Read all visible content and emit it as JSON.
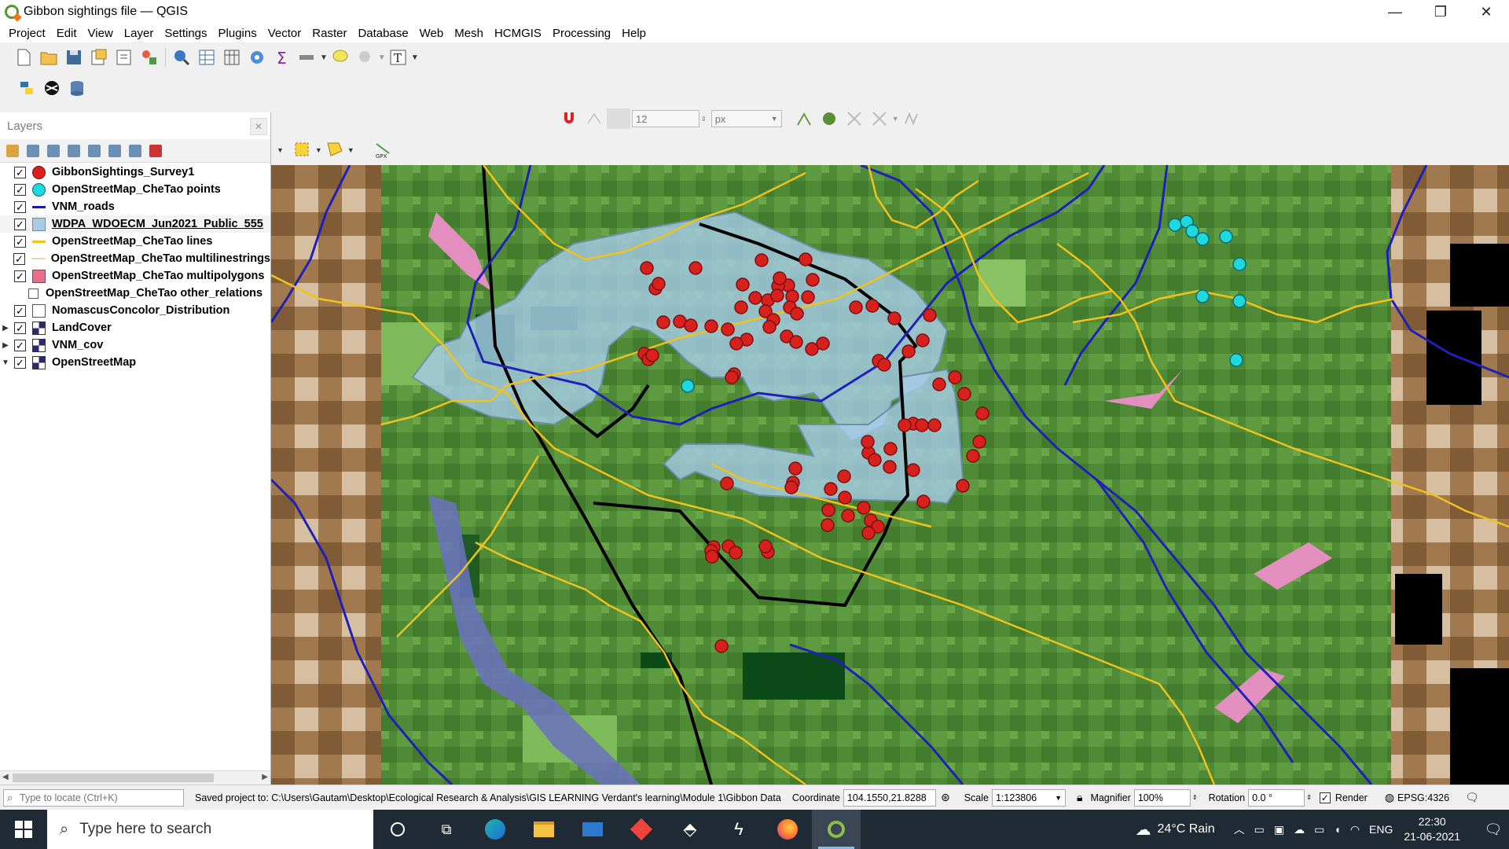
{
  "window": {
    "title": "Gibbon sightings file — QGIS",
    "controls": [
      "—",
      "❐",
      "✕"
    ]
  },
  "menu": [
    "Project",
    "Edit",
    "View",
    "Layer",
    "Settings",
    "Plugins",
    "Vector",
    "Raster",
    "Database",
    "Web",
    "Mesh",
    "HCMGIS",
    "Processing",
    "Help"
  ],
  "snapping": {
    "tolerance": "12",
    "unit": "px"
  },
  "layers_panel": {
    "title": "Layers",
    "layers": [
      {
        "name": "GibbonSightings_Survey1",
        "symbol": "red-point",
        "checked": true,
        "expander": ""
      },
      {
        "name": "OpenStreetMap_CheTao points",
        "symbol": "cyan-point",
        "checked": true,
        "expander": ""
      },
      {
        "name": "VNM_roads",
        "symbol": "blue-line",
        "checked": true,
        "expander": ""
      },
      {
        "name": "WDPA_WDOECM_Jun2021_Public_555",
        "symbol": "blue-polygon",
        "checked": true,
        "expander": ""
      },
      {
        "name": "OpenStreetMap_CheTao lines",
        "symbol": "yellow-line",
        "checked": true,
        "expander": ""
      },
      {
        "name": "OpenStreetMap_CheTao multilinestrings",
        "symbol": "thin-line",
        "checked": true,
        "expander": ""
      },
      {
        "name": "OpenStreetMap_CheTao multipolygons",
        "symbol": "pink-polygon",
        "checked": true,
        "expander": ""
      },
      {
        "name": "OpenStreetMap_CheTao other_relations",
        "symbol": "table",
        "checked": null,
        "expander": ""
      },
      {
        "name": "NomascusConcolor_Distribution",
        "symbol": "vector",
        "checked": true,
        "expander": ""
      },
      {
        "name": "LandCover",
        "symbol": "raster",
        "checked": true,
        "expander": "▶"
      },
      {
        "name": "VNM_cov",
        "symbol": "raster",
        "checked": true,
        "expander": "▶"
      },
      {
        "name": "OpenStreetMap",
        "symbol": "raster",
        "checked": true,
        "expander": "▼"
      }
    ]
  },
  "statusbar": {
    "locator_placeholder": "Type to locate (Ctrl+K)",
    "message": "Saved project to: C:\\Users\\Gautam\\Desktop\\Ecological Research & Analysis\\GIS LEARNING Verdant's learning\\Module 1\\Gibbon Data",
    "coordinate_label": "Coordinate",
    "coordinate": "104.1550,21.8288",
    "scale_label": "Scale",
    "scale": "1:123806",
    "magnifier_label": "Magnifier",
    "magnifier": "100%",
    "rotation_label": "Rotation",
    "rotation": "0.0 °",
    "render_label": "Render",
    "crs": "EPSG:4326"
  },
  "taskbar": {
    "search_placeholder": "Type here to search",
    "weather": "24°C  Rain",
    "lang": "ENG",
    "time": "22:30",
    "date": "21-06-2021"
  },
  "colors": {
    "sightings": "#d8201c",
    "osm_points": "#1ed8e0",
    "roads": "#1a1aa8",
    "protected_area": "#a6cce8",
    "osm_lines": "#f2c21a"
  }
}
